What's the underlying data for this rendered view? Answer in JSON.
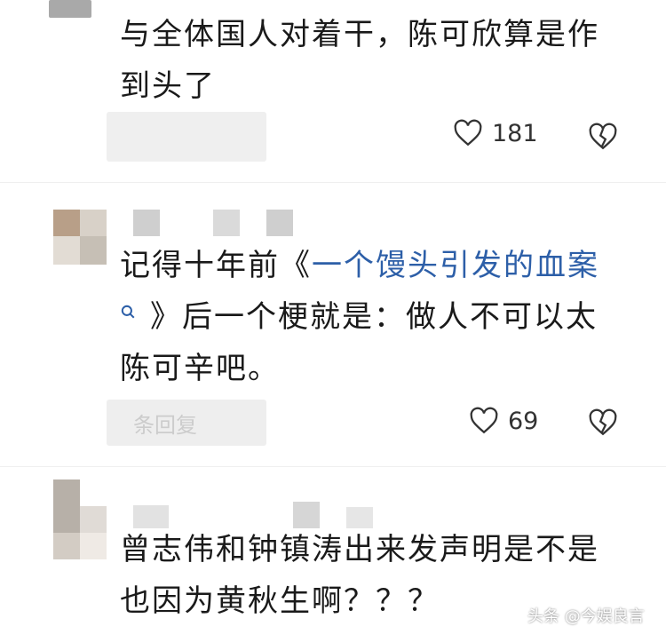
{
  "comments": [
    {
      "text_line1": "与全体国人对着干，陈可欣算是作",
      "text_line2": "到头了",
      "likes": "181"
    },
    {
      "text_prefix": "记得十年前《",
      "link_text": "一个馒头引发的血案",
      "text_line2": "》后一个梗就是：做人不可以太",
      "text_line3": "陈可辛吧。",
      "reply_hint": "条回复",
      "likes": "69"
    },
    {
      "text_line1": "曾志伟和钟镇涛出来发声明是不是",
      "text_line2": "也因为黄秋生啊？？？"
    }
  ],
  "watermark": "头条 @今娱良言",
  "icons": [
    "like-heart-icon",
    "broken-heart-icon",
    "search-icon"
  ]
}
